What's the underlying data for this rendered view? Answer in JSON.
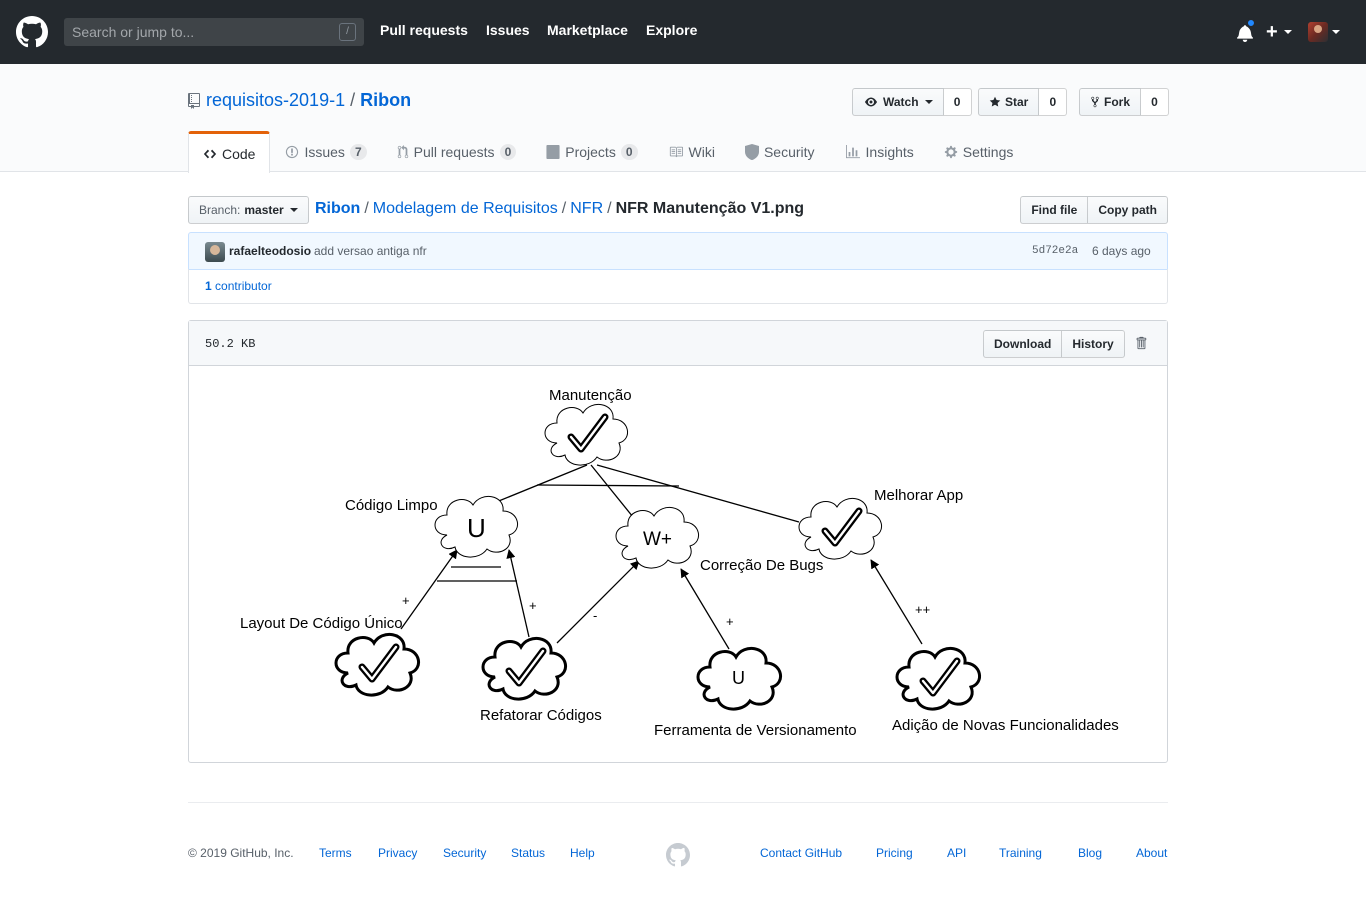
{
  "header": {
    "search_placeholder": "Search or jump to...",
    "search_hotkey": "/",
    "nav": [
      "Pull requests",
      "Issues",
      "Marketplace",
      "Explore"
    ],
    "plus": "+"
  },
  "repo": {
    "owner": "requisitos-2019-1",
    "separator": "/",
    "name": "Ribon",
    "watch": {
      "label": "Watch",
      "count": "0"
    },
    "star": {
      "label": "Star",
      "count": "0"
    },
    "fork": {
      "label": "Fork",
      "count": "0"
    }
  },
  "tabs": [
    {
      "label": "Code"
    },
    {
      "label": "Issues",
      "count": "7"
    },
    {
      "label": "Pull requests",
      "count": "0"
    },
    {
      "label": "Projects",
      "count": "0"
    },
    {
      "label": "Wiki"
    },
    {
      "label": "Security"
    },
    {
      "label": "Insights"
    },
    {
      "label": "Settings"
    }
  ],
  "filenav": {
    "branch_label": "Branch:",
    "branch": "master",
    "path_root": "Ribon",
    "path": [
      "Modelagem de Requisitos",
      "NFR"
    ],
    "sep": "/",
    "filename": "NFR Manutenção V1.png",
    "find_file": "Find file",
    "copy_path": "Copy path"
  },
  "commit": {
    "author": "rafaelteodosio",
    "message": "add versao antiga nfr",
    "sha": "5d72e2a",
    "time": "6 days ago",
    "contributors_count": "1",
    "contributors_label": "contributor"
  },
  "file": {
    "size": "50.2 KB",
    "download": "Download",
    "history": "History"
  },
  "diagram": {
    "top": "Manutenção",
    "codigo_limpo": "Código Limpo",
    "codigo_limpo_symbol": "U",
    "correcao_symbol": "W+",
    "correcao": "Correção De Bugs",
    "melhorar": "Melhorar App",
    "layout": "Layout De Código Único",
    "refatorar": "Refatorar Códigos",
    "ferramenta_symbol": "U",
    "ferramenta": "Ferramenta de Versionamento",
    "adicao": "Adição de Novas Funcionalidades",
    "contrib_layout": "+",
    "contrib_refatorar_cl": "+",
    "contrib_refatorar_cb": "-",
    "contrib_ferramenta": "+",
    "contrib_adicao": "++"
  },
  "footer": {
    "copyright": "© 2019 GitHub, Inc.",
    "left_links": [
      "Terms",
      "Privacy",
      "Security",
      "Status",
      "Help"
    ],
    "right_links": [
      "Contact GitHub",
      "Pricing",
      "API",
      "Training",
      "Blog",
      "About"
    ]
  }
}
